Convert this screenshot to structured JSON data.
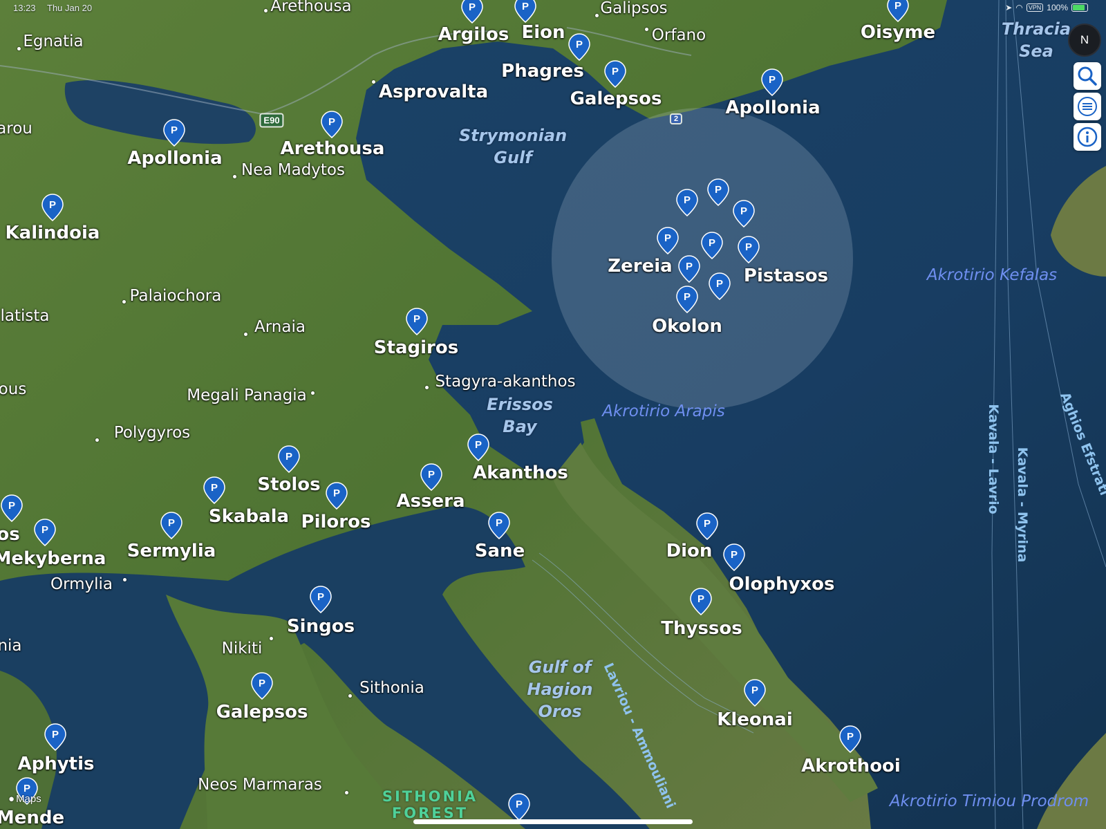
{
  "status_bar": {
    "time": "13:23",
    "date": "Thu Jan 20",
    "vpn": "VPN",
    "battery": "100%",
    "battery_level": 1.0
  },
  "attribution": "Maps",
  "labels": [
    {
      "id": "arethousa-top",
      "text": "Arethousa",
      "kind": "town"
    },
    {
      "id": "egnatia",
      "text": "Egnatia",
      "kind": "town"
    },
    {
      "id": "argilos",
      "text": "Argilos",
      "kind": "city"
    },
    {
      "id": "eion",
      "text": "Eion",
      "kind": "city"
    },
    {
      "id": "galipsos",
      "text": "Galipsos",
      "kind": "town"
    },
    {
      "id": "orfano",
      "text": "Orfano",
      "kind": "town"
    },
    {
      "id": "oisyme",
      "text": "Oisyme",
      "kind": "city"
    },
    {
      "id": "phagres",
      "text": "Phagres",
      "kind": "city"
    },
    {
      "id": "asprovalta",
      "text": "Asprovalta",
      "kind": "city"
    },
    {
      "id": "galepsos-north",
      "text": "Galepsos",
      "kind": "city"
    },
    {
      "id": "apollonia-east",
      "text": "Apollonia",
      "kind": "city"
    },
    {
      "id": "arou",
      "text": "arou",
      "kind": "town"
    },
    {
      "id": "apollonia-west",
      "text": "Apollonia",
      "kind": "city"
    },
    {
      "id": "arethousa",
      "text": "Arethousa",
      "kind": "city"
    },
    {
      "id": "nea-madytos",
      "text": "Nea Madytos",
      "kind": "town"
    },
    {
      "id": "kalindoia",
      "text": "Kalindoia",
      "kind": "city"
    },
    {
      "id": "zereia",
      "text": "Zereia",
      "kind": "city"
    },
    {
      "id": "pistasos",
      "text": "Pistasos",
      "kind": "city"
    },
    {
      "id": "okolon",
      "text": "Okolon",
      "kind": "city"
    },
    {
      "id": "palaiochora",
      "text": "Palaiochora",
      "kind": "town"
    },
    {
      "id": "latista",
      "text": "latista",
      "kind": "town"
    },
    {
      "id": "arnaia",
      "text": "Arnaia",
      "kind": "town"
    },
    {
      "id": "stagiros",
      "text": "Stagiros",
      "kind": "city"
    },
    {
      "id": "stagyra-akanthos",
      "text": "Stagyra-akanthos",
      "kind": "town"
    },
    {
      "id": "ous",
      "text": "ous",
      "kind": "town"
    },
    {
      "id": "megali-panagia",
      "text": "Megali Panagia",
      "kind": "town"
    },
    {
      "id": "polygyros",
      "text": "Polygyros",
      "kind": "town"
    },
    {
      "id": "akanthos",
      "text": "Akanthos",
      "kind": "city"
    },
    {
      "id": "stolos",
      "text": "Stolos",
      "kind": "city"
    },
    {
      "id": "skabala",
      "text": "Skabala",
      "kind": "city"
    },
    {
      "id": "assera",
      "text": "Assera",
      "kind": "city"
    },
    {
      "id": "piloros",
      "text": "Piloros",
      "kind": "city"
    },
    {
      "id": "sermylia",
      "text": "Sermylia",
      "kind": "city"
    },
    {
      "id": "os",
      "text": "os",
      "kind": "city"
    },
    {
      "id": "mekyberna",
      "text": "Mekyberna",
      "kind": "city"
    },
    {
      "id": "ormylia",
      "text": "Ormylia",
      "kind": "town"
    },
    {
      "id": "sane",
      "text": "Sane",
      "kind": "city"
    },
    {
      "id": "dion",
      "text": "Dion",
      "kind": "city"
    },
    {
      "id": "olophyxos",
      "text": "Olophyxos",
      "kind": "city"
    },
    {
      "id": "thyssos",
      "text": "Thyssos",
      "kind": "city"
    },
    {
      "id": "singos",
      "text": "Singos",
      "kind": "city"
    },
    {
      "id": "nikiti",
      "text": "Nikiti",
      "kind": "town"
    },
    {
      "id": "nia",
      "text": "nia",
      "kind": "town"
    },
    {
      "id": "sithonia",
      "text": "Sithonia",
      "kind": "town"
    },
    {
      "id": "galepsos-south",
      "text": "Galepsos",
      "kind": "city"
    },
    {
      "id": "kleonai",
      "text": "Kleonai",
      "kind": "city"
    },
    {
      "id": "aphytis",
      "text": "Aphytis",
      "kind": "city"
    },
    {
      "id": "neos-marmaras",
      "text": "Neos Marmaras",
      "kind": "town"
    },
    {
      "id": "akrothooi",
      "text": "Akrothooi",
      "kind": "city"
    },
    {
      "id": "mende",
      "text": "Mende",
      "kind": "city"
    },
    {
      "id": "strymonian-gulf",
      "text": "Strymonian\nGulf",
      "kind": "water"
    },
    {
      "id": "thracian-sea",
      "text": "Thracia\nSea",
      "kind": "water"
    },
    {
      "id": "erissos-bay",
      "text": "Erissos\nBay",
      "kind": "water"
    },
    {
      "id": "gulf-hagion-oros",
      "text": "Gulf of\nHagion\nOros",
      "kind": "water"
    },
    {
      "id": "akrotirio-kefalas",
      "text": "Akrotirio Kefalas",
      "kind": "cape"
    },
    {
      "id": "akrotirio-arapis",
      "text": "Akrotirio Arapis",
      "kind": "cape"
    },
    {
      "id": "akrotirio-timiou",
      "text": "Akrotirio Timiou Prodrom",
      "kind": "cape"
    },
    {
      "id": "route-kavala-lavrio",
      "text": "Kavala - Lavrio",
      "kind": "route"
    },
    {
      "id": "route-kavala-myrina",
      "text": "Kavala - Myrina",
      "kind": "route"
    },
    {
      "id": "route-aghios",
      "text": "Aghios Efstrati",
      "kind": "route"
    },
    {
      "id": "route-lavriou",
      "text": "Lavriou - Ammouliani",
      "kind": "route"
    },
    {
      "id": "sithonia-forest",
      "text": "SITHONIA\nFOREST",
      "kind": "forest"
    }
  ],
  "pin_label": "P",
  "pin_color": "#1a63c6",
  "road_shields": [
    {
      "id": "e90",
      "text": "E90",
      "style": "green"
    },
    {
      "id": "route2",
      "text": "2",
      "style": "blue"
    }
  ],
  "controls": {
    "compass": "N",
    "search": "search-icon",
    "layers": "layers-icon",
    "info": "info-icon"
  }
}
